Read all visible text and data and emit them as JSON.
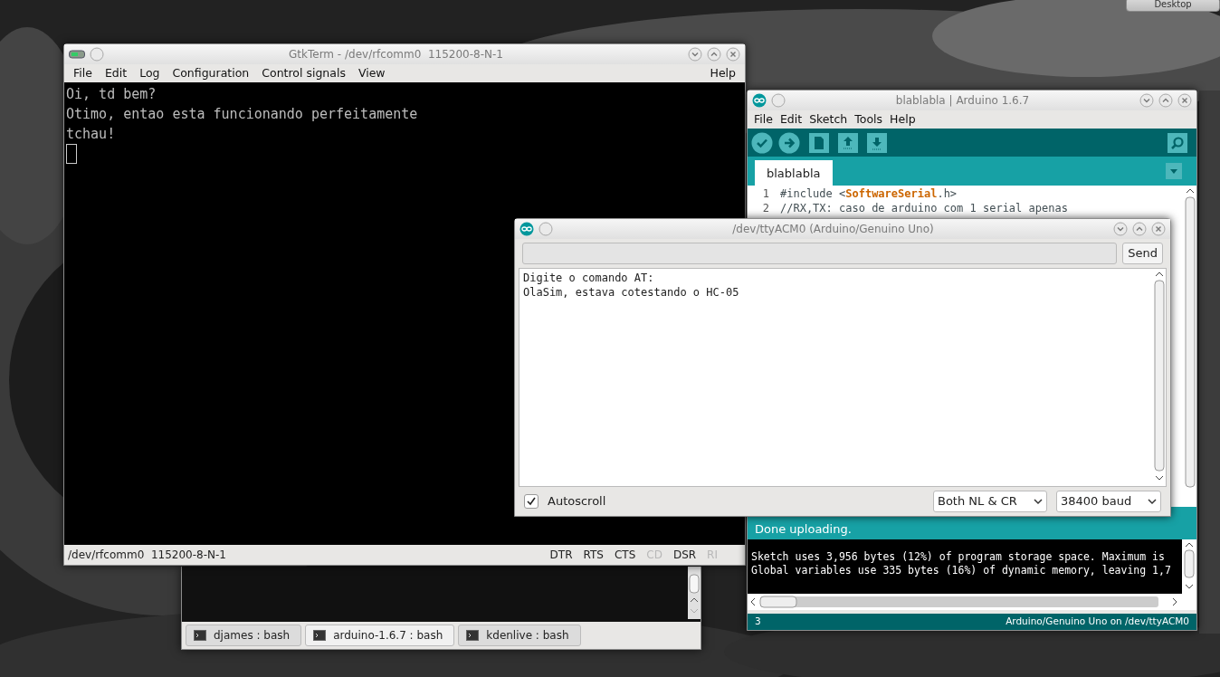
{
  "desktop_button": "Desktop",
  "gtkterm": {
    "title": "GtkTerm - /dev/rfcomm0  115200-8-N-1",
    "menus": [
      "File",
      "Edit",
      "Log",
      "Configuration",
      "Control signals",
      "View"
    ],
    "help_menu": "Help",
    "lines": [
      "Oi, td bem?",
      "Otimo, entao esta funcionando perfeitamente",
      "tchau!"
    ],
    "port_status": "/dev/rfcomm0  115200-8-N-1",
    "signals": [
      {
        "label": "DTR",
        "on": true
      },
      {
        "label": "RTS",
        "on": true
      },
      {
        "label": "CTS",
        "on": true
      },
      {
        "label": "CD",
        "on": false
      },
      {
        "label": "DSR",
        "on": true
      },
      {
        "label": "RI",
        "on": false
      }
    ]
  },
  "konsole": {
    "tabs": [
      {
        "label": "djames : bash",
        "selected": false
      },
      {
        "label": "arduino-1.6.7 : bash",
        "selected": true
      },
      {
        "label": "kdenlive : bash",
        "selected": false
      }
    ]
  },
  "arduino": {
    "title": "blablabla | Arduino 1.6.7",
    "menus": [
      "File",
      "Edit",
      "Sketch",
      "Tools",
      "Help"
    ],
    "tabs": [
      {
        "label": "blablabla",
        "selected": true
      }
    ],
    "code": [
      {
        "number": "1",
        "text": "#include <**SoftwareSerial**.h>"
      },
      {
        "number": "2",
        "text": "//RX,TX: caso de arduino com 1 serial apenas"
      }
    ],
    "message": "Done uploading.",
    "console": [
      "Sketch uses 3,956 bytes (12%) of program storage space. Maximum is",
      "Global variables use 335 bytes (16%) of dynamic memory, leaving 1,7"
    ],
    "line": "3",
    "board": "Arduino/Genuino Uno on /dev/ttyACM0"
  },
  "serial_monitor": {
    "title": "/dev/ttyACM0 (Arduino/Genuino Uno)",
    "send": "Send",
    "lines": [
      "Digite o comando AT:",
      "OlaSim, estava cotestando o HC-05"
    ],
    "autoscroll": {
      "label": "Autoscroll",
      "checked": true
    },
    "line_ending": "Both NL & CR",
    "baud": "38400 baud"
  }
}
